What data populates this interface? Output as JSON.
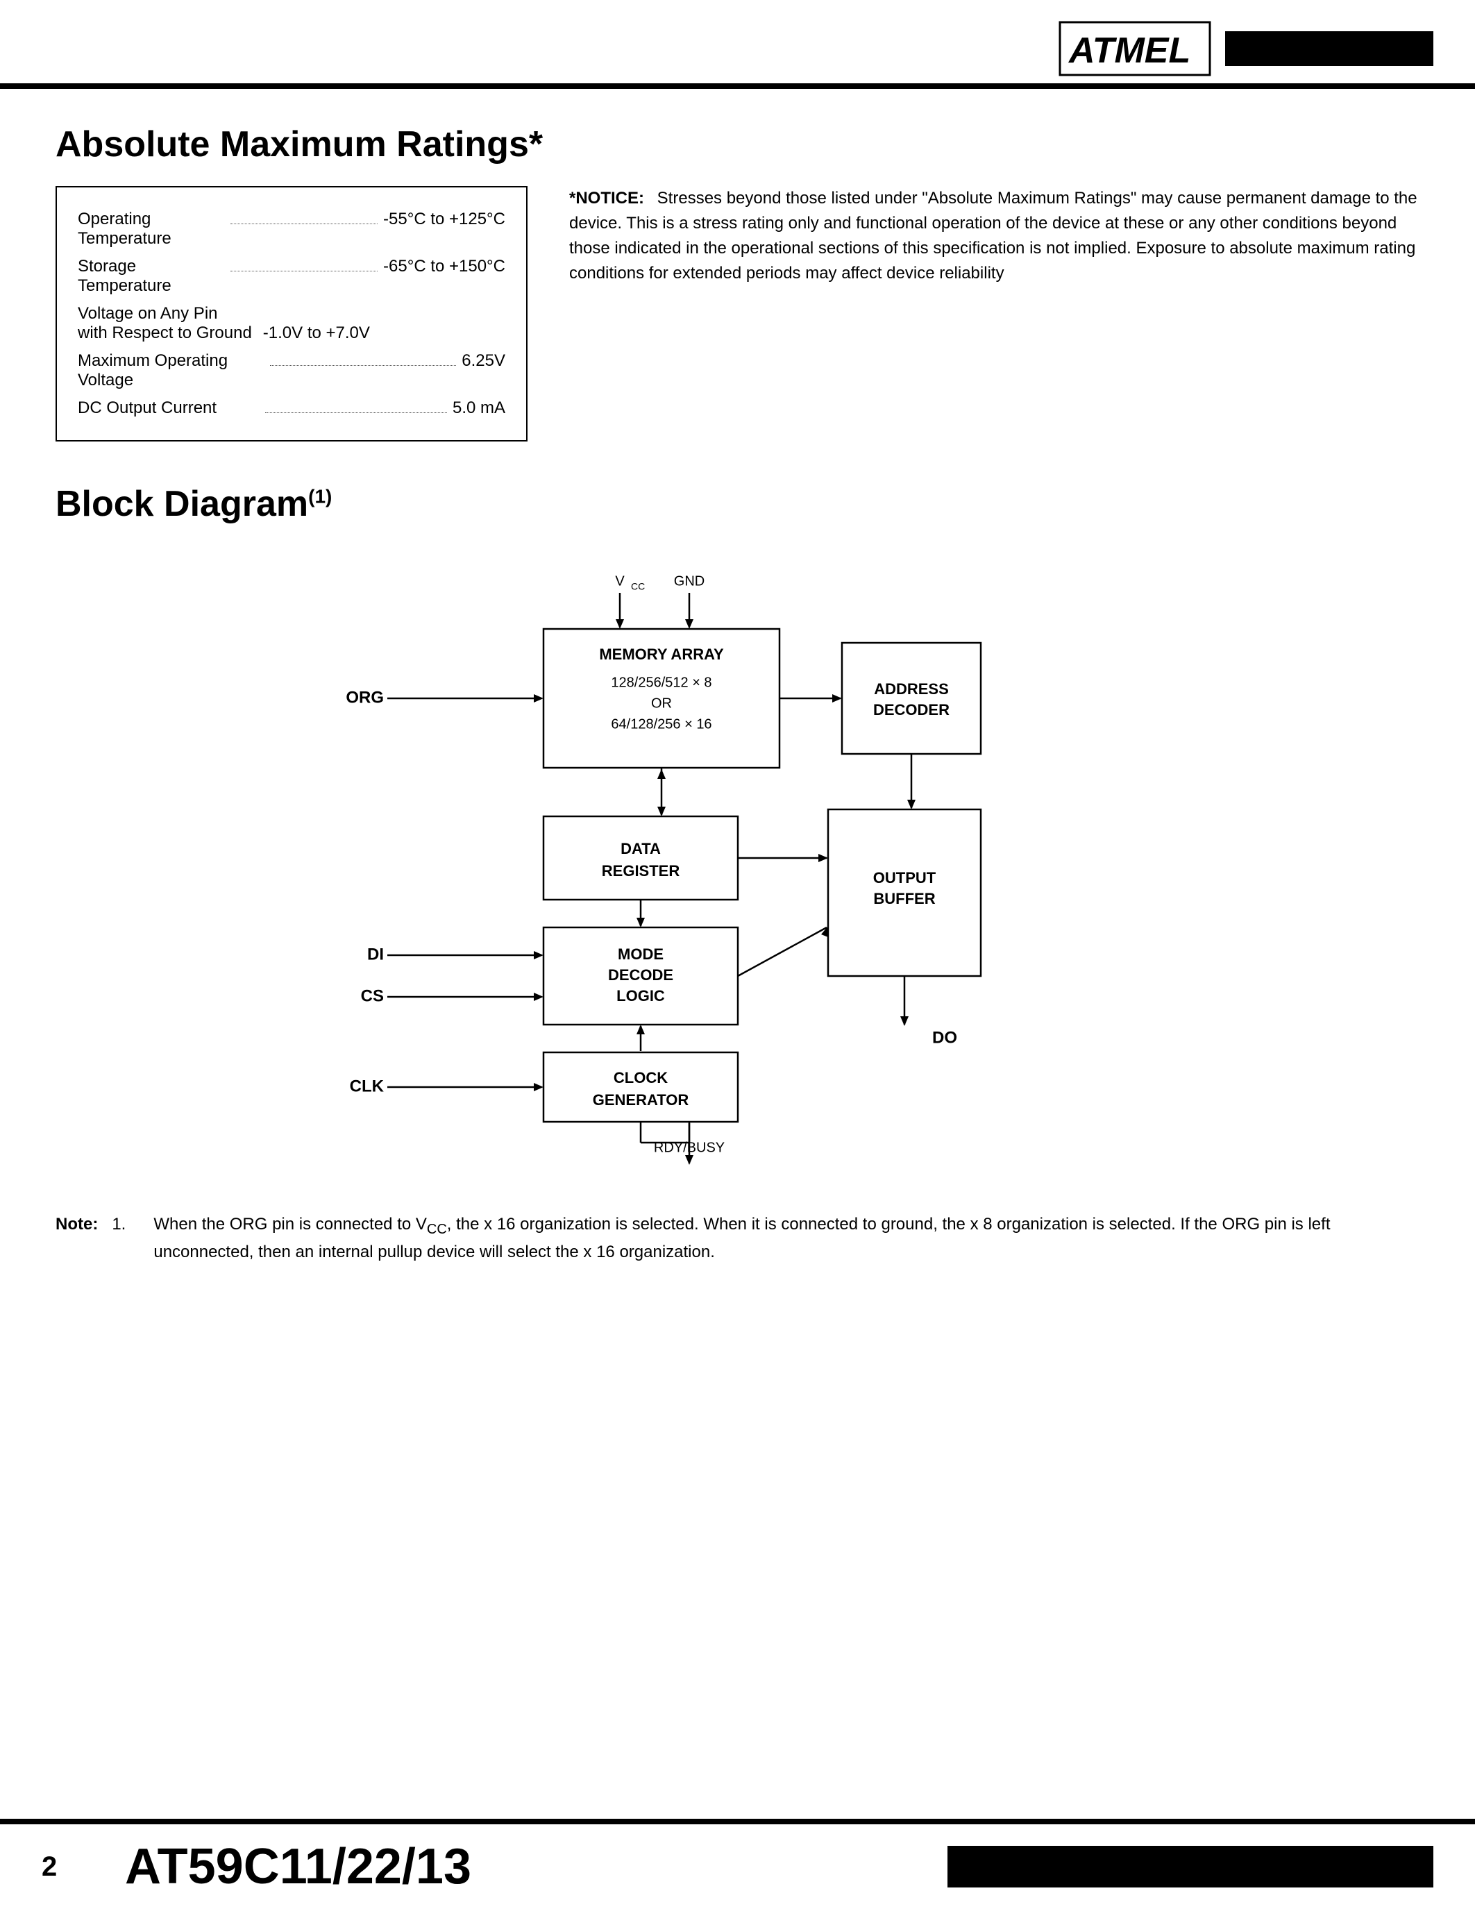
{
  "header": {
    "logo_text": "ATMEL",
    "logo_svg_alt": "Atmel logo"
  },
  "absolute_maximum_ratings": {
    "title": "Absolute Maximum Ratings*",
    "notice_label": "*NOTICE:",
    "notice_text": "Stresses beyond those listed under \"Absolute Maximum Ratings\" may cause permanent damage to the device. This is a stress rating only and functional operation of the device at these or any other conditions beyond those indicated in the operational sections of this specification is not implied. Exposure to absolute maximum rating conditions for extended periods may affect device reliability",
    "rows": [
      {
        "label": "Operating Temperature",
        "value": "-55°C to +125°C"
      },
      {
        "label": "Storage Temperature",
        "value": "-65°C to +150°C"
      },
      {
        "label": "Voltage on Any Pin\nwith Respect to Ground",
        "value": "-1.0V to +7.0V"
      },
      {
        "label": "Maximum Operating Voltage",
        "value": "6.25V"
      },
      {
        "label": "DC Output Current",
        "value": "5.0 mA"
      }
    ]
  },
  "block_diagram": {
    "title": "Block Diagram",
    "superscript": "(1)",
    "labels": {
      "vcc": "V",
      "vcc_sub": "CC",
      "gnd": "GND",
      "memory_array": "MEMORY ARRAY",
      "memory_org": "128/256/512 × 8",
      "memory_or": "OR",
      "memory_org2": "64/128/256 × 16",
      "org": "ORG",
      "address_decoder": "ADDRESS\nDECODER",
      "data_register": "DATA\nREGISTER",
      "mode_decode": "MODE\nDECODE\nLOGIC",
      "di": "DI",
      "cs": "CS",
      "output_buffer": "OUTPUT\nBUFFER",
      "clock_generator": "CLOCK\nGENERATOR",
      "clk": "CLK",
      "do": "DO",
      "rdy_busy": "RDY/BUSY"
    }
  },
  "note": {
    "label": "Note:",
    "number": "1.",
    "text": "When the ORG pin is connected to Vₙ₂, the x 16 organization is selected. When it is connected to ground, the x 8 organization is selected. If the ORG pin is left unconnected, then an internal pullup device will select the x 16 organization."
  },
  "footer": {
    "page": "2",
    "model": "AT59C11/22/13"
  }
}
